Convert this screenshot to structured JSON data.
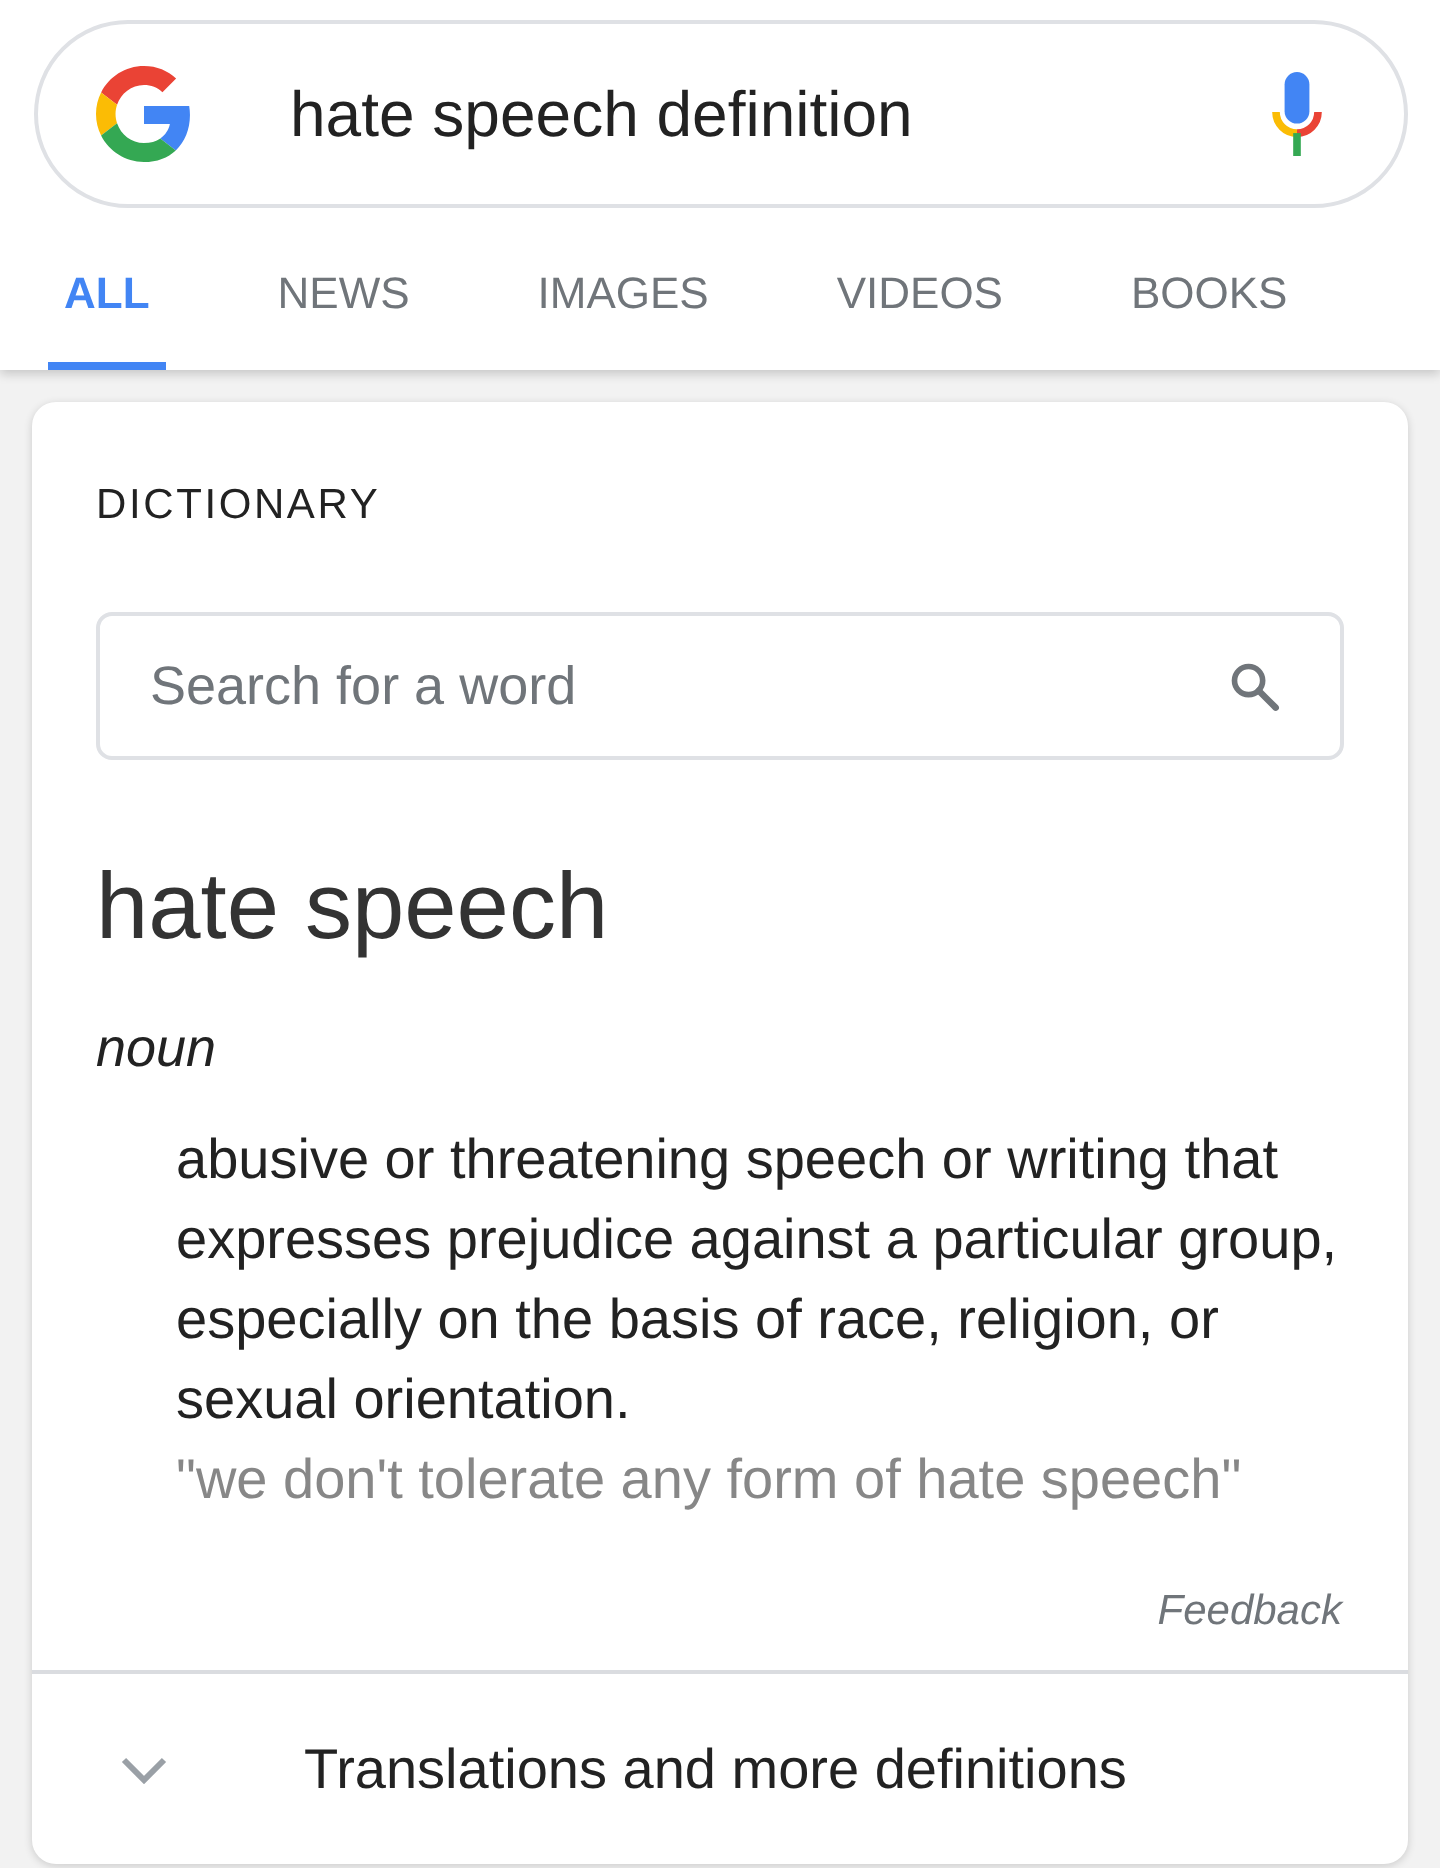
{
  "search_bar": {
    "query": "hate speech definition"
  },
  "tabs": [
    {
      "label": "ALL",
      "selected": true
    },
    {
      "label": "NEWS",
      "selected": false
    },
    {
      "label": "IMAGES",
      "selected": false
    },
    {
      "label": "VIDEOS",
      "selected": false
    },
    {
      "label": "BOOKS",
      "selected": false
    }
  ],
  "dictionary": {
    "heading": "DICTIONARY",
    "search": {
      "placeholder": "Search for a word"
    },
    "word": "hate speech",
    "part_of_speech": "noun",
    "definition": "abusive or threatening speech or writing that expresses prejudice against a particular group, especially on the basis of race, religion, or sexual orientation.",
    "example": "\"we don't tolerate any form of hate speech\"",
    "feedback": "Feedback"
  },
  "more": {
    "label": "Translations and more definitions",
    "expanded": false
  }
}
